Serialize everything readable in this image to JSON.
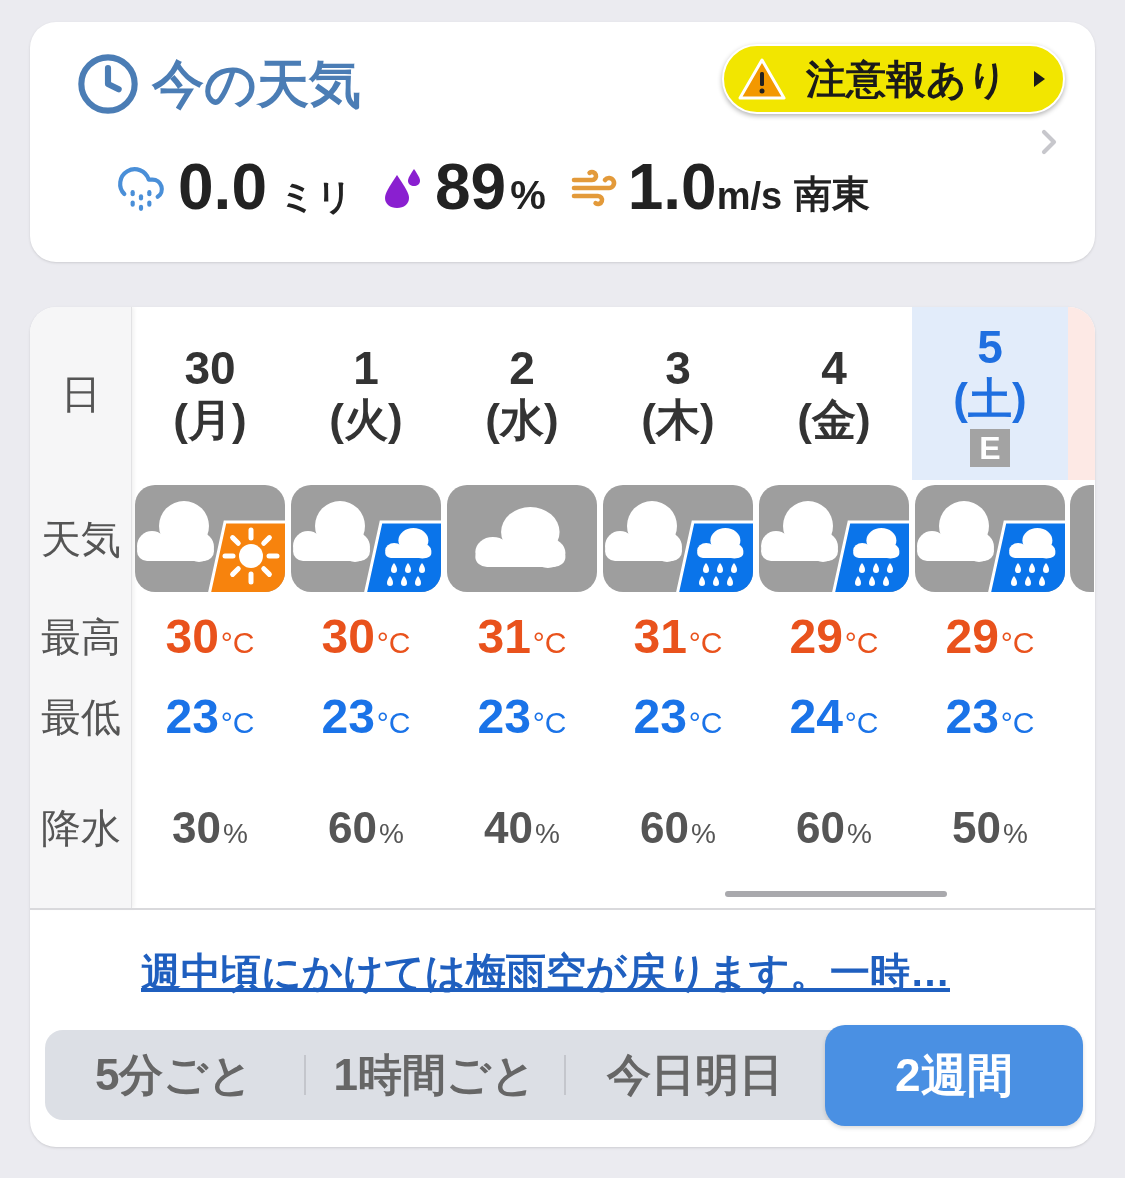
{
  "current": {
    "title": "今の天気",
    "alert": {
      "label": "注意報あり"
    },
    "precipitation": {
      "value": "0.0",
      "unit": "ミリ"
    },
    "humidity": {
      "value": "89",
      "unit": "%"
    },
    "wind": {
      "value": "1.0",
      "unit": "m/s",
      "direction": "南東"
    }
  },
  "forecast": {
    "row_labels": [
      "日",
      "天気",
      "最高",
      "最低",
      "降水"
    ],
    "days": [
      {
        "date": "30",
        "weekday": "(月)",
        "kind": "weekday",
        "weather": {
          "kind": "cloudy_sunny"
        },
        "high": {
          "value": "30",
          "unit": "°C"
        },
        "low": {
          "value": "23",
          "unit": "°C"
        },
        "precip": {
          "value": "30",
          "unit": "%"
        }
      },
      {
        "date": "1",
        "weekday": "(火)",
        "kind": "weekday",
        "weather": {
          "kind": "cloudy_rainy"
        },
        "high": {
          "value": "30",
          "unit": "°C"
        },
        "low": {
          "value": "23",
          "unit": "°C"
        },
        "precip": {
          "value": "60",
          "unit": "%"
        }
      },
      {
        "date": "2",
        "weekday": "(水)",
        "kind": "weekday",
        "weather": {
          "kind": "cloudy"
        },
        "high": {
          "value": "31",
          "unit": "°C"
        },
        "low": {
          "value": "23",
          "unit": "°C"
        },
        "precip": {
          "value": "40",
          "unit": "%"
        }
      },
      {
        "date": "3",
        "weekday": "(木)",
        "kind": "weekday",
        "weather": {
          "kind": "cloudy_rainy"
        },
        "high": {
          "value": "31",
          "unit": "°C"
        },
        "low": {
          "value": "23",
          "unit": "°C"
        },
        "precip": {
          "value": "60",
          "unit": "%"
        }
      },
      {
        "date": "4",
        "weekday": "(金)",
        "kind": "weekday",
        "weather": {
          "kind": "cloudy_rainy"
        },
        "high": {
          "value": "29",
          "unit": "°C"
        },
        "low": {
          "value": "24",
          "unit": "°C"
        },
        "precip": {
          "value": "60",
          "unit": "%"
        }
      },
      {
        "date": "5",
        "weekday": "(土)",
        "kind": "saturday",
        "reliability": "E",
        "weather": {
          "kind": "cloudy_rainy"
        },
        "high": {
          "value": "29",
          "unit": "°C"
        },
        "low": {
          "value": "23",
          "unit": "°C"
        },
        "precip": {
          "value": "50",
          "unit": "%"
        }
      }
    ],
    "next_day": {
      "kind": "sunday"
    }
  },
  "summary_link": "週中頃にかけては梅雨空が戻ります。一時…",
  "range_tabs": [
    {
      "label": "5分ごと",
      "selected": false
    },
    {
      "label": "1時間ごと",
      "selected": false
    },
    {
      "label": "今日明日",
      "selected": false
    },
    {
      "label": "2週間",
      "selected": true
    }
  ]
}
